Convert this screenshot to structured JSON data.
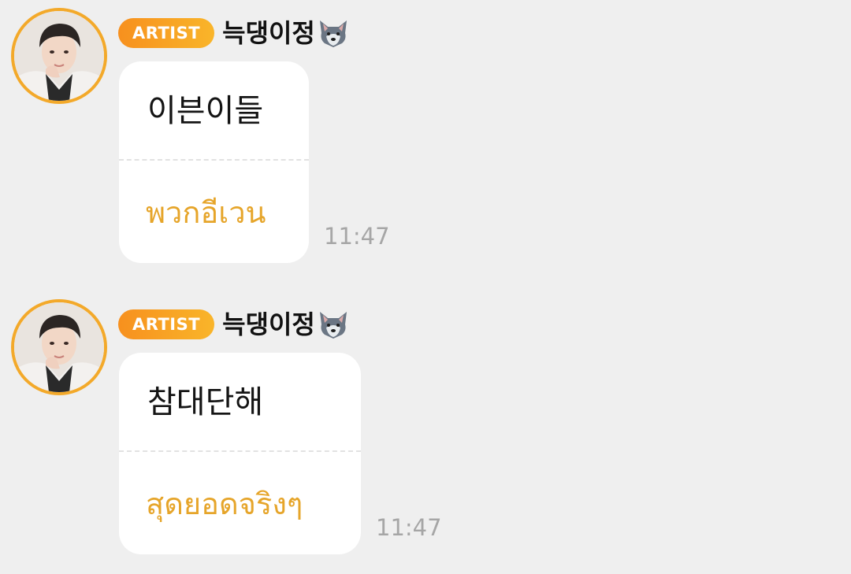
{
  "messages": [
    {
      "badge": "ARTIST",
      "sender": "늑댕이정",
      "sender_icon": "wolf-icon",
      "original_text": "이븐이들",
      "translated_text": "พวกอีเวน",
      "time": "11:47"
    },
    {
      "badge": "ARTIST",
      "sender": "늑댕이정",
      "sender_icon": "wolf-icon",
      "original_text": "참대단해",
      "translated_text": "สุดยอดจริงๆ",
      "time": "11:47"
    }
  ],
  "colors": {
    "background": "#efefef",
    "badge_start": "#f7901e",
    "badge_end": "#f9b52a",
    "avatar_ring": "#f3a92a",
    "translation_text": "#e6a52a",
    "timestamp": "#a6a6a6"
  }
}
